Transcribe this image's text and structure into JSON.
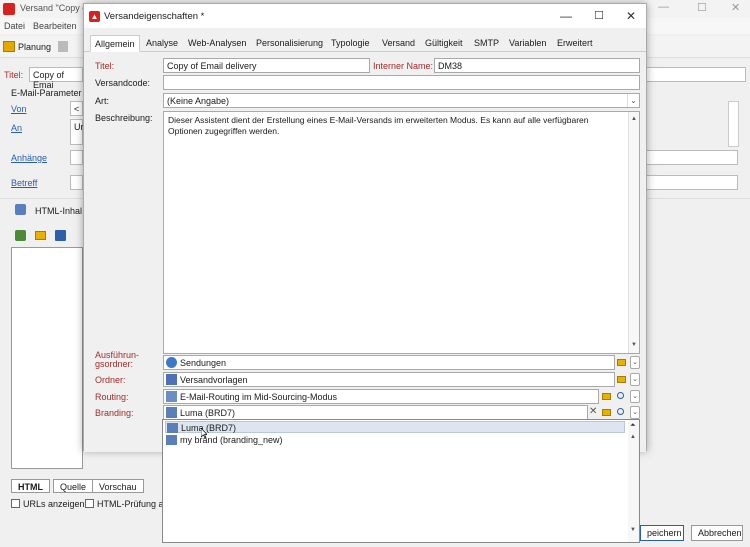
{
  "background": {
    "title": "Versand \"Copy o",
    "menu": [
      "Datei",
      "Bearbeiten"
    ],
    "toolbar_label": "Planung",
    "titel_label": "Titel:",
    "titel_value": "Copy of Emai",
    "section_label": "E-Mail-Parameter",
    "links": {
      "von": "Von",
      "an": "An",
      "anhaenge": "Anhänge",
      "betreff": "Betreff"
    },
    "von_value": "<",
    "an_value": "Ur",
    "html_section": "HTML-Inhal",
    "bottom_tabs": [
      "HTML",
      "Quelle",
      "Vorschau"
    ],
    "checkbox_urls": "URLs anzeigen",
    "checkbox_html": "HTML-Prüfung a",
    "btn_save": "peichern",
    "btn_cancel": "Abbrechen"
  },
  "dialog": {
    "title": "Versandeigenschaften *",
    "tabs": [
      "Allgemein",
      "Analyse",
      "Web-Analysen",
      "Personalisierung",
      "Typologie",
      "Versand",
      "Gültigkeit",
      "SMTP",
      "Variablen",
      "Erweitert"
    ],
    "active_tab": "Allgemein",
    "fields": {
      "titel_label": "Titel:",
      "titel_value": "Copy of Email delivery",
      "interner_name_label": "Interner Name:",
      "interner_name_value": "DM38",
      "versandcode_label": "Versandcode:",
      "versandcode_value": "",
      "art_label": "Art:",
      "art_value": "(Keine Angabe)",
      "beschreibung_label": "Beschreibung:",
      "beschreibung_value": "Dieser Assistent dient der Erstellung eines E-Mail-Versands im erweiterten Modus. Es kann auf alle verfügbaren Optionen zugegriffen werden.",
      "ausfuehrungsordner_label_1": "Ausführun-",
      "ausfuehrungsordner_label_2": "gsordner:",
      "ausfuehrungsordner_value": "Sendungen",
      "ordner_label": "Ordner:",
      "ordner_value": "Versandvorlagen",
      "routing_label": "Routing:",
      "routing_value": "E-Mail-Routing im Mid-Sourcing-Modus",
      "branding_label": "Branding:",
      "branding_value": "Luma (BRD7)"
    },
    "dropdown_items": [
      "Luma (BRD7)",
      "my brand (branding_new)"
    ]
  },
  "colors": {
    "accent_red": "#d9211e",
    "label_red": "#a32c2c",
    "link_blue": "#2a5db0",
    "selection": "#dde6f0"
  }
}
